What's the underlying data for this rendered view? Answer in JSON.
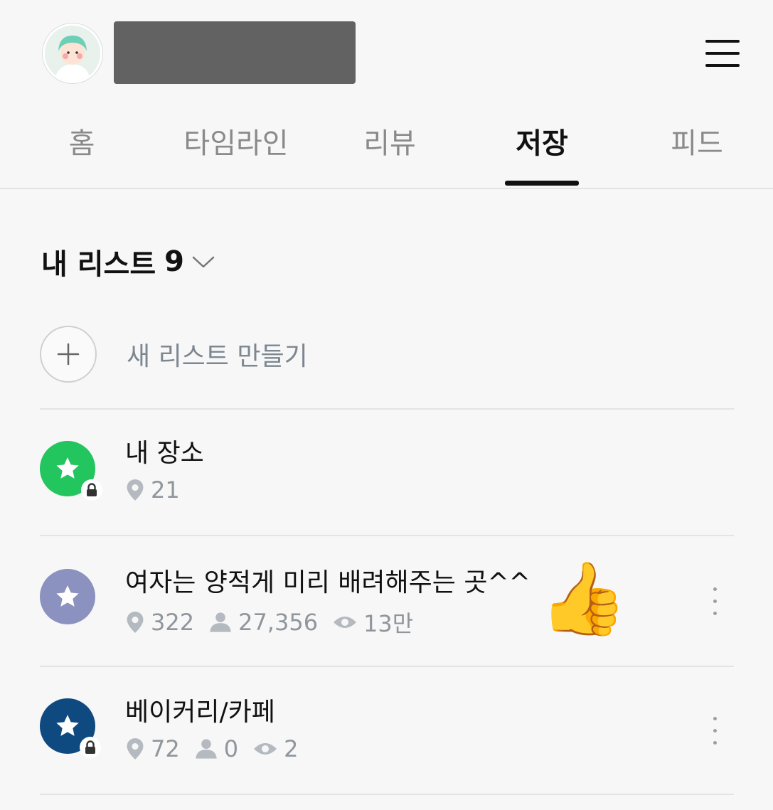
{
  "tabs": [
    {
      "label": "홈"
    },
    {
      "label": "타임라인"
    },
    {
      "label": "리뷰"
    },
    {
      "label": "저장",
      "active": true
    },
    {
      "label": "피드"
    }
  ],
  "list_header": {
    "title": "내 리스트",
    "count": "9"
  },
  "new_list": {
    "label": "새 리스트 만들기"
  },
  "lists": [
    {
      "title": "내 장소",
      "icon_color": "#22c55e",
      "locked": true,
      "places": "21"
    },
    {
      "title": "여자는 양적게 미리 배려해주는 곳^^",
      "icon_color": "#8b92c0",
      "locked": false,
      "places": "322",
      "followers": "27,356",
      "views": "13만",
      "emoji": "👍"
    },
    {
      "title": "베이커리/카페",
      "icon_color": "#0e4a80",
      "locked": true,
      "places": "72",
      "followers": "0",
      "views": "2"
    }
  ],
  "icons": [
    "menu-icon",
    "chevron-down-icon",
    "plus-icon",
    "star-icon",
    "lock-icon",
    "pin-icon",
    "person-icon",
    "eye-icon",
    "more-vertical-icon"
  ]
}
